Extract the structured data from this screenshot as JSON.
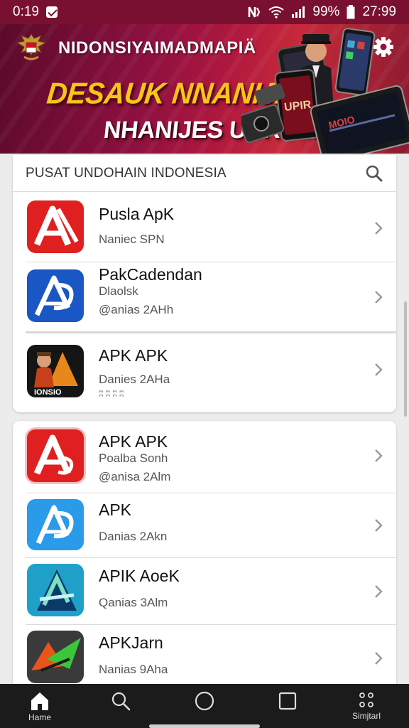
{
  "status_bar": {
    "time_left": "0:19",
    "battery": "99%",
    "time_right": "27:99",
    "icons": [
      "notification-icon",
      "nfc-icon",
      "wifi-icon",
      "signal-icon"
    ]
  },
  "banner": {
    "title": "NIDONSIYAIMADMAPIÄ",
    "headline_1": "DESAUK NNANIJA",
    "headline_2": "NHANIJES UUROIINA",
    "device_text": "UPIR",
    "device_text_2": "MOIO"
  },
  "search": {
    "label": "PUSAT UNDOHAIN INDONESIA"
  },
  "list_1": [
    {
      "name": "Pusla ApK",
      "sub": "Naniec SPN",
      "sub2": "",
      "icon": "apk-red-icon",
      "color": "#e02020"
    },
    {
      "name": "PakCadendan",
      "sub": "Dlaolsk",
      "sub2": "@anias 2AHh",
      "icon": "apk-blue-icon",
      "color": "#1a56c4"
    },
    {
      "name": "APK  APK",
      "sub": "Danies 2AHa",
      "sub2": "ʭ ʭ ʭ ʭ",
      "icon": "apk-game-icon",
      "color": "#151515",
      "icon_caption": "IONSIO"
    }
  ],
  "list_2": [
    {
      "name": "APK APK",
      "sub": "Poalba Sonh",
      "sub2": "@anisa 2Alm",
      "icon": "apk-red-icon",
      "color": "#e02020"
    },
    {
      "name": "APK",
      "sub": "Danias 2Akn",
      "sub2": "",
      "icon": "apk-light-blue-icon",
      "color": "#2a9be8"
    },
    {
      "name": "APIK AoeK",
      "sub": "Qanias 3Alm",
      "sub2": "",
      "icon": "apk-teal-icon",
      "color": "#1fa0c8"
    },
    {
      "name": "APKJarn",
      "sub": "Nanias 9Aha",
      "sub2": "",
      "icon": "apk-dark-icon",
      "color": "#3a3a3a"
    }
  ],
  "nav": {
    "home_label": "Hame",
    "more_label": "Simjtarl"
  }
}
